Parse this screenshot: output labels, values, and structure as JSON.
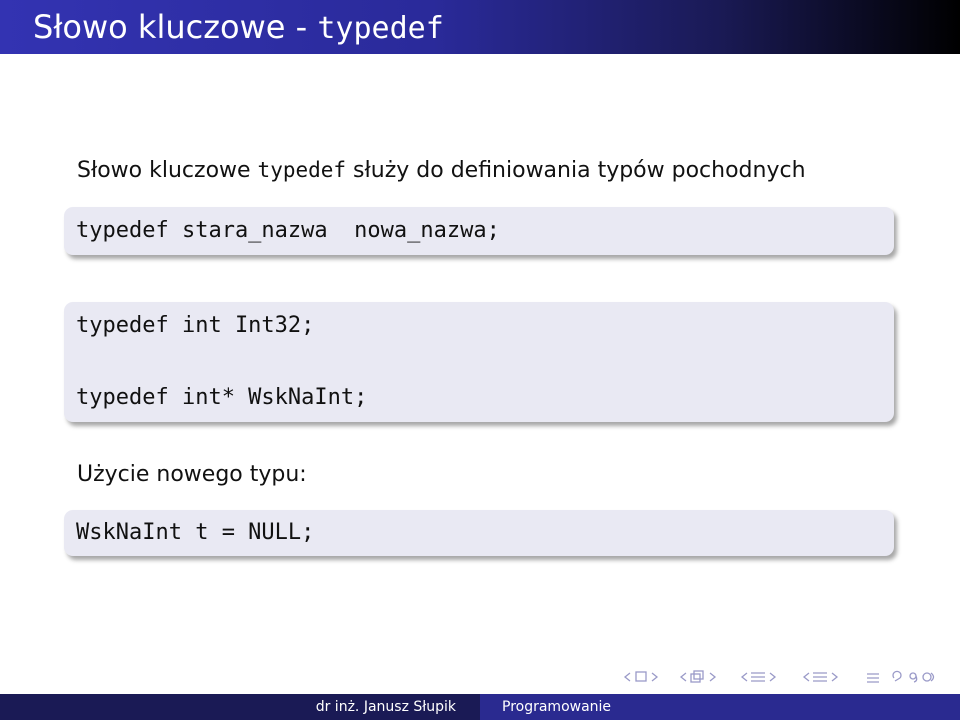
{
  "slide": {
    "title_prefix": "Słowo kluczowe - ",
    "title_keyword": "typedef"
  },
  "intro": {
    "before": "Słowo kluczowe ",
    "keyword": "typedef",
    "after": " służy do definiowania typów pochodnych"
  },
  "syntax_block": {
    "line1": "typedef stara_nazwa  nowa_nazwa;"
  },
  "examples_block": {
    "line1": "typedef int Int32;",
    "line2": "typedef int* WskNaInt;"
  },
  "usage": {
    "label": "Użycie nowego typu:",
    "code": "WskNaInt t = NULL;"
  },
  "navigation": {
    "icons": [
      "frame-prev-icon",
      "frame-next-icon",
      "subsection-prev-icon",
      "subsection-next-icon",
      "section-prev-icon",
      "section-next-icon",
      "align-icon",
      "search-icon"
    ]
  },
  "footer": {
    "author": "dr inż. Janusz Słupik",
    "course": "Programowanie"
  }
}
